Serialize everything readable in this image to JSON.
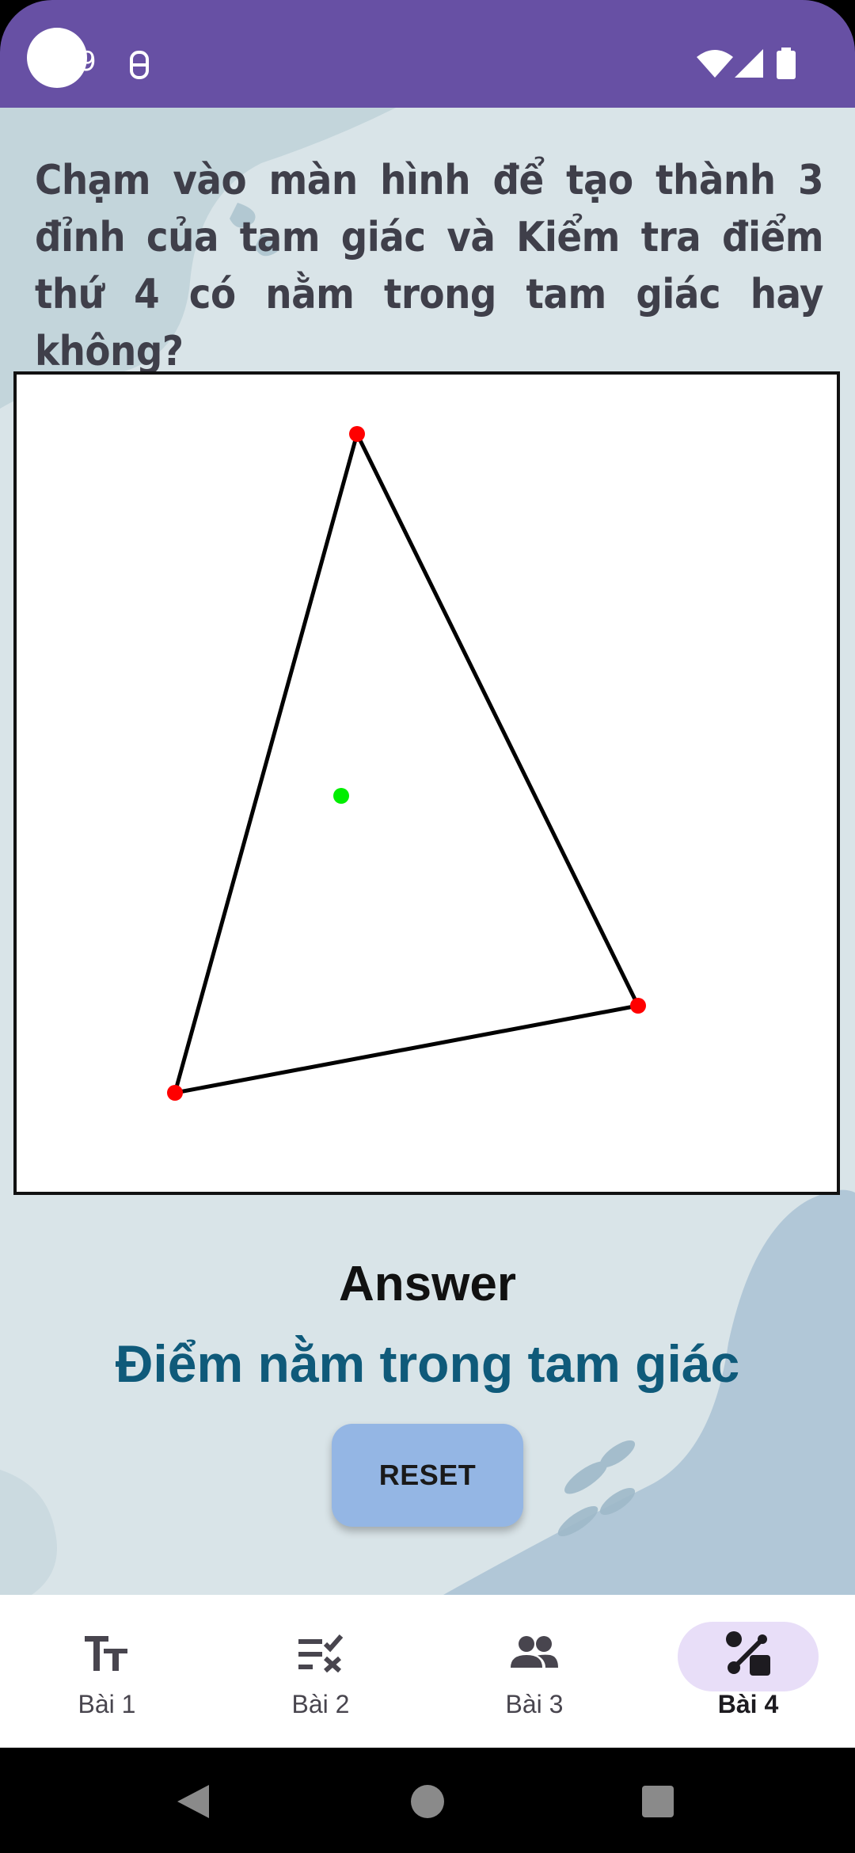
{
  "status_bar": {
    "time": "9",
    "background": "#6750a4",
    "icons": [
      "notification-icon",
      "wifi-icon",
      "signal-icon",
      "battery-icon"
    ]
  },
  "instruction": "Chạm vào màn hình để tạo thành 3 đỉnh của tam giác và Kiểm tra điểm thứ 4 có nằm trong tam giác hay không?",
  "canvas": {
    "vertex_color": "#ff0000",
    "test_point_color": "#00ee00",
    "edge_color": "#000000"
  },
  "answer": {
    "title": "Answer",
    "text": "Điểm nằm trong tam giác",
    "text_color": "#0f5a7a"
  },
  "reset_button": {
    "label": "RESET",
    "color": "#94b6e4"
  },
  "bottom_nav": {
    "items": [
      {
        "label": "Bài 1",
        "icon": "text-fields-icon",
        "active": false
      },
      {
        "label": "Bài 2",
        "icon": "checklist-icon",
        "active": false
      },
      {
        "label": "Bài 3",
        "icon": "people-icon",
        "active": false
      },
      {
        "label": "Bài 4",
        "icon": "geometry-icon",
        "active": true
      }
    ],
    "active_color": "#e8def8"
  },
  "system_nav": {
    "buttons": [
      "back-icon",
      "home-icon",
      "recents-icon"
    ]
  }
}
